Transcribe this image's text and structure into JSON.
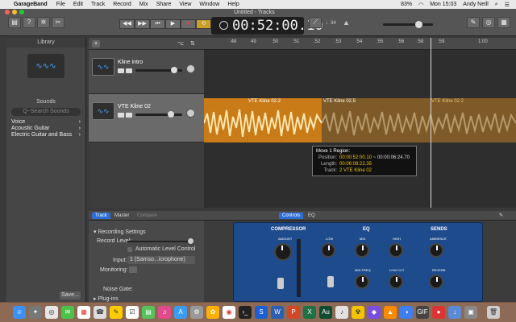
{
  "menubar": {
    "app_name": "GarageBand",
    "items": [
      "File",
      "Edit",
      "Track",
      "Record",
      "Mix",
      "Share",
      "View",
      "Window",
      "Help"
    ],
    "battery": "83%",
    "clock": "Mon 15:03",
    "user": "Andy Neill"
  },
  "window": {
    "title": "Untitled - Tracks"
  },
  "toolbar": {
    "lcd_time": "00:52:00.10",
    "tempo": "♩34"
  },
  "library": {
    "title": "Library",
    "sounds_header": "Sounds",
    "search_placeholder": "Q~Search Sounds",
    "categories": [
      "Voice",
      "Acoustic Guitar",
      "Electric Guitar and Bass"
    ],
    "save_label": "Save..."
  },
  "tracks": [
    {
      "name": "Kline intro"
    },
    {
      "name": "VTE Kline 02"
    }
  ],
  "ruler": {
    "ticks": [
      ":48",
      "49",
      ":50",
      ":51",
      ":52",
      ":53",
      ":54",
      ":55",
      ":56",
      ":57",
      ":58",
      ":59",
      "1:00"
    ]
  },
  "regions": [
    {
      "label": "VTE Kline 02.2"
    },
    {
      "label": "VTE Kline 02.5"
    },
    {
      "label": "VTE Kline 02.2"
    }
  ],
  "tooltip": {
    "title": "Move 1 Region:",
    "position_label": "Position:",
    "position_value": "00:00:52:00.10",
    "position_delta": "~ 00:00:06:24.70",
    "length_label": "Length:",
    "length_value": "00:06:08:22.35",
    "track_label": "Track:",
    "track_value": "2  VTE Kline 02"
  },
  "editor": {
    "tab_track": "Track",
    "tab_master": "Master",
    "tab_compare": "Compare",
    "tab_controls": "Controls",
    "tab_eq": "EQ",
    "recording_settings": "Recording Settings",
    "record_level": "Record Level:",
    "auto_level": "Automatic Level Control",
    "input_label": "Input:",
    "input_value": "1 (Samso...icrophone)",
    "monitoring": "Monitoring:",
    "noise_gate": "Noise Gate:",
    "plugins": "Plug-ins"
  },
  "panel": {
    "compressor": "COMPRESSOR",
    "eq": "EQ",
    "sends": "SENDS",
    "amount": "AMOUNT",
    "low": "LOW",
    "mid": "MID",
    "high": "HIGH",
    "mid_freq": "MID FREQ",
    "low_cut": "LOW CUT",
    "ambience": "AMBIENCE",
    "reverb": "REVERB"
  }
}
